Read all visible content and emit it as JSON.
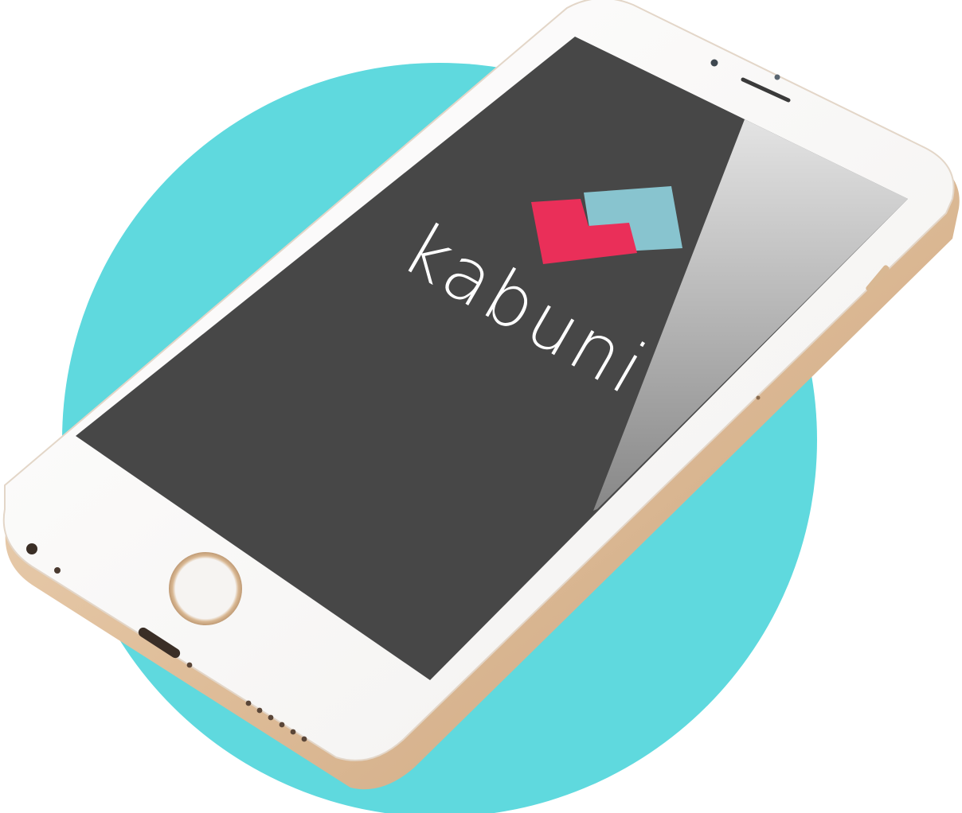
{
  "app": {
    "brand_name": "kabuni"
  },
  "colors": {
    "background": "#ffffff",
    "backdrop_circle": "#5fd9de",
    "phone_body": "#fdfcfb",
    "phone_frame_gold": "#e6c9a8",
    "screen": "#474747",
    "logo_pink": "#ea2f59",
    "logo_teal": "#88c4cf",
    "brand_text": "#ffffff"
  },
  "icons": {
    "home_button": "home-button",
    "camera": "front-camera-icon",
    "speaker": "earpiece-speaker",
    "logo": "kabuni-logo-icon"
  }
}
